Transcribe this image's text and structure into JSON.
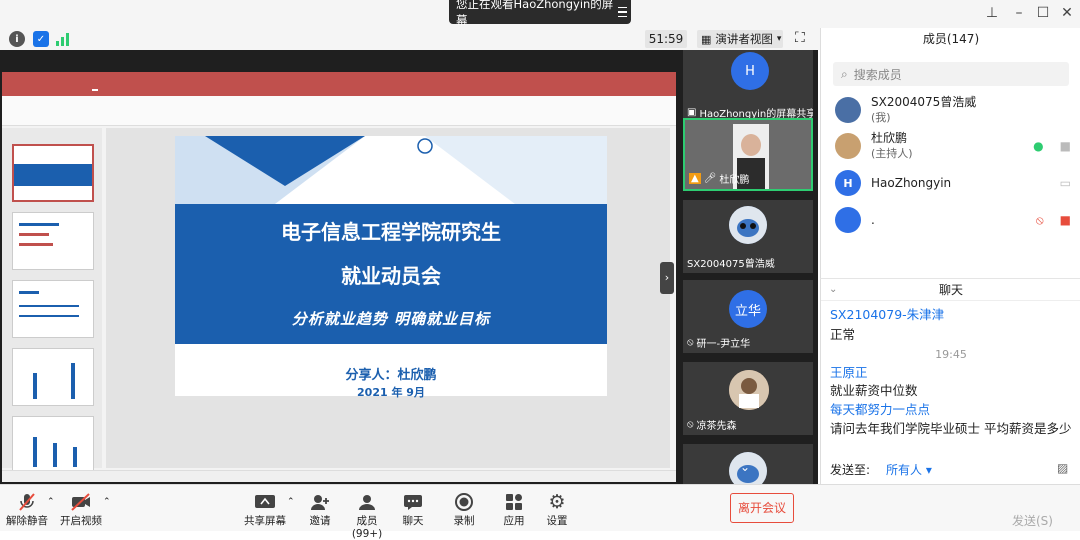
{
  "banner": {
    "text": "您正在观看HaoZhongyin的屏幕"
  },
  "toolbar": {
    "timer": "51:59",
    "view_label": "演讲者视图"
  },
  "slide": {
    "title_line1": "电子信息工程学院研究生",
    "title_line2": "就业动员会",
    "subtitle": "分析就业趋势 明确就业目标",
    "presenter": "分享人：杜欣鹏",
    "date": "2021 年 9月"
  },
  "videos": [
    {
      "name": "HaoZhongyin的屏幕共享",
      "avatar": "H"
    },
    {
      "name": "杜欣鹏"
    },
    {
      "name": "SX2004075曾浩威"
    },
    {
      "name": "研一-尹立华",
      "avatar": "立华"
    },
    {
      "name": "凉茶先森"
    }
  ],
  "members": {
    "title": "成员(147)",
    "search_placeholder": "搜索成员",
    "list": [
      {
        "name": "SX2004075曾浩威",
        "sub": "(我)"
      },
      {
        "name": "杜欣鹏",
        "sub": "(主持人)"
      },
      {
        "name": "HaoZhongyin",
        "avatar": "H"
      },
      {
        "name": "."
      }
    ]
  },
  "chat": {
    "title": "聊天",
    "messages": [
      {
        "sender": "SX2104079-朱津津"
      },
      {
        "text": "正常"
      },
      {
        "time": "19:45"
      },
      {
        "sender": "王原正"
      },
      {
        "text": "就业薪资中位数"
      },
      {
        "sender": "每天都努力一点点"
      },
      {
        "text": "请问去年我们学院毕业硕士 平均薪资是多少"
      }
    ],
    "send_to_label": "发送至:",
    "send_to_value": "所有人",
    "send_button": "发送(S)"
  },
  "bottom": {
    "unmute": "解除静音",
    "start_video": "开启视频",
    "share_screen": "共享屏幕",
    "invite": "邀请",
    "members": "成员(99+)",
    "chat": "聊天",
    "record": "录制",
    "apps": "应用",
    "settings": "设置",
    "leave": "离开会议"
  },
  "colors": {
    "accent": "#1a73e8",
    "slide_blue": "#1b5fae",
    "ppt_red": "#c0504d",
    "leave_red": "#e74c3c"
  }
}
